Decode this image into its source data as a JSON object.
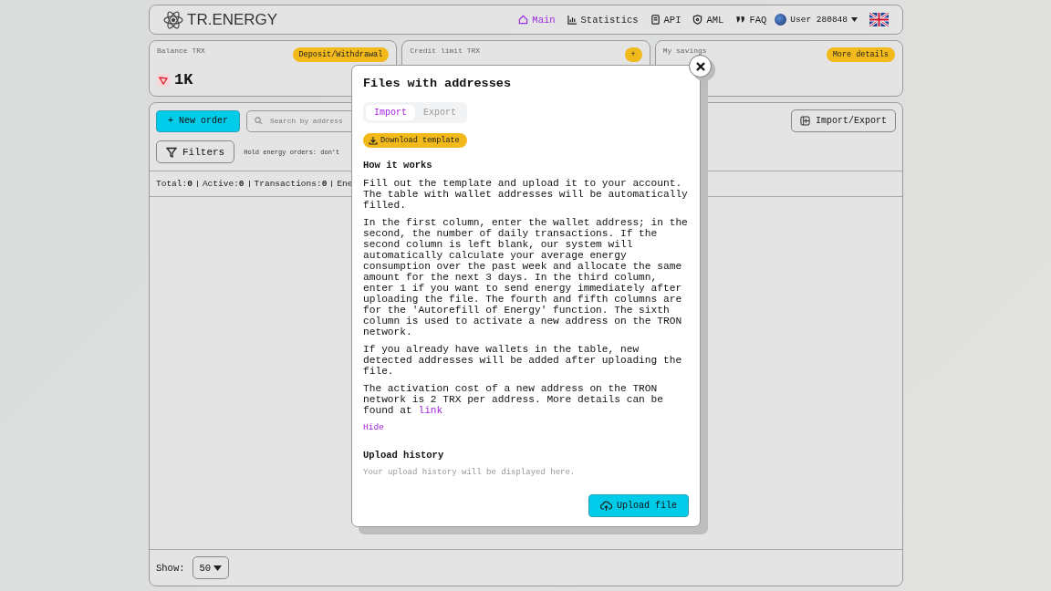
{
  "header": {
    "logo": "TR.ENERGY",
    "nav": [
      {
        "label": "Main",
        "selected": true
      },
      {
        "label": "Statistics",
        "selected": false
      },
      {
        "label": "API",
        "selected": false
      },
      {
        "label": "AML",
        "selected": false
      },
      {
        "label": "FAQ",
        "selected": false
      }
    ],
    "user": "User 280848"
  },
  "cards": [
    {
      "label": "Balance TRX",
      "button": "Deposit/Withdrawal",
      "value": "1K"
    },
    {
      "label": "Credit limit TRX",
      "button": "+"
    },
    {
      "label": "My savings",
      "button": "More details"
    }
  ],
  "orders": {
    "new_order": "+ New order",
    "search_placeholder": "Search by address",
    "import_export": "Import/Export",
    "filters": "Filters",
    "hold_note": "Hold energy orders: don't",
    "stats": [
      {
        "label": "Total:",
        "value": "0"
      },
      {
        "label": "Active:",
        "value": "0"
      },
      {
        "label": "Transactions:",
        "value": "0"
      },
      {
        "label": "Ene"
      }
    ],
    "show_label": "Show:",
    "page_size": "50"
  },
  "modal": {
    "title": "Files with addresses",
    "tabs": [
      {
        "label": "Import",
        "selected": true
      },
      {
        "label": "Export",
        "selected": false
      }
    ],
    "download": "Download template",
    "how_title": "How it works",
    "paragraphs": [
      {
        "text": "Fill out the template and upload it to your account. The table with wallet addresses will be automatically filled."
      },
      {
        "text": "In the first column, enter the wallet address; in the second, the number of daily transactions. If the second column is left blank, our system will automatically calculate your average energy consumption over the past week and allocate the same amount for the next 3 days. In the third column, enter 1 if you want to send energy immediately after uploading the file. The fourth and fifth columns are for the 'Autorefill of Energy' function. The sixth column is used to activate a new address on the TRON network."
      },
      {
        "text": "If you already have wallets in the table, new detected addresses will be added after uploading the file."
      },
      {
        "text": "The activation cost of a new address on the TRON network is 2 TRX per address. More details can be found at",
        "link": "link"
      }
    ],
    "hide": "Hide",
    "history_title": "Upload history",
    "history_empty": "Your upload history will be displayed here.",
    "upload": "Upload file"
  }
}
